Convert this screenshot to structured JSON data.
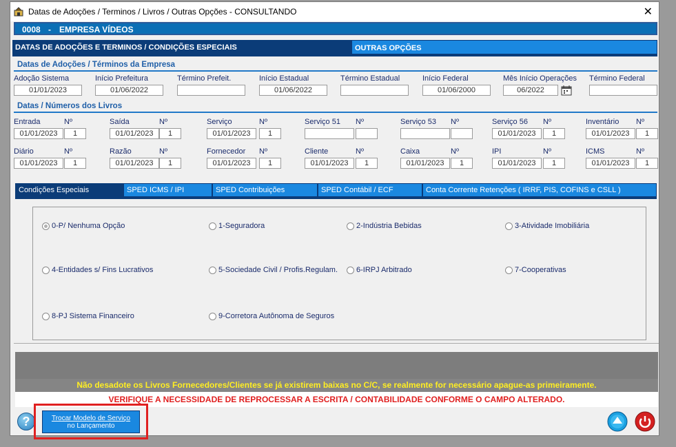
{
  "window": {
    "title": "Datas de Adoções / Terminos / Livros / Outras Opções - CONSULTANDO"
  },
  "empresa": {
    "code": "0008",
    "separator": "-",
    "name": "EMPRESA VÍDEOS"
  },
  "main_tabs": {
    "active": "DATAS DE ADOÇÕES E TERMINOS / CONDIÇÕES ESPECIAIS",
    "other": "OUTRAS OPÇÕES"
  },
  "adocoes": {
    "heading": "Datas de Adoções / Términos da Empresa",
    "fields": [
      {
        "label": "Adoção Sistema",
        "value": "01/01/2023"
      },
      {
        "label": "Início Prefeitura",
        "value": "01/06/2022"
      },
      {
        "label": "Término Prefeit.",
        "value": ""
      },
      {
        "label": "Início Estadual",
        "value": "01/06/2022"
      },
      {
        "label": "Término Estadual",
        "value": ""
      },
      {
        "label": "Início Federal",
        "value": "01/06/2000"
      },
      {
        "label": "Mês Início Operações",
        "value": "06/2022"
      },
      {
        "label": "Término Federal",
        "value": ""
      }
    ]
  },
  "livros": {
    "heading": "Datas / Números dos Livros",
    "num_label": "Nº",
    "row1": [
      {
        "label": "Entrada",
        "date": "01/01/2023",
        "num": "1"
      },
      {
        "label": "Saída",
        "date": "01/01/2023",
        "num": "1"
      },
      {
        "label": "Serviço",
        "date": "01/01/2023",
        "num": "1"
      },
      {
        "label": "Serviço 51",
        "date": "",
        "num": ""
      },
      {
        "label": "Serviço 53",
        "date": "",
        "num": ""
      },
      {
        "label": "Serviço 56",
        "date": "01/01/2023",
        "num": "1"
      },
      {
        "label": "Inventário",
        "date": "01/01/2023",
        "num": "1"
      }
    ],
    "row2": [
      {
        "label": "Diário",
        "date": "01/01/2023",
        "num": "1"
      },
      {
        "label": "Razão",
        "date": "01/01/2023",
        "num": "1"
      },
      {
        "label": "Fornecedor",
        "date": "01/01/2023",
        "num": "1"
      },
      {
        "label": "Cliente",
        "date": "01/01/2023",
        "num": "1"
      },
      {
        "label": "Caixa",
        "date": "01/01/2023",
        "num": "1"
      },
      {
        "label": "IPI",
        "date": "01/01/2023",
        "num": "1"
      },
      {
        "label": "ICMS",
        "date": "01/01/2023",
        "num": "1"
      }
    ]
  },
  "sub_tabs": [
    "Condições Especiais",
    "SPED ICMS / IPI",
    "SPED Contribuições",
    "SPED Contábil / ECF",
    "Conta Corrente Retenções ( IRRF, PIS, COFINS  e  CSLL )"
  ],
  "options": [
    "0-P/ Nenhuma Opção",
    "1-Seguradora",
    "2-Indústria Bebidas",
    "3-Atividade Imobiliária",
    "4-Entidades s/ Fins Lucrativos",
    "5-Sociedade Civil / Profis.Regulam.",
    "6-IRPJ Arbitrado",
    "7-Cooperativas",
    "8-PJ Sistema Financeiro",
    "9-Corretora Autônoma de Seguros"
  ],
  "selected_option": "0-P/ Nenhuma Opção",
  "messages": {
    "warning_yellow": "Não desadote os Livros Fornecedores/Clientes se já existirem baixas no C/C, se realmente for necessário apague-as primeiramente.",
    "warning_red": "VERIFIQUE A NECESSIDADE DE REPROCESSAR A ESCRITA / CONTABILIDADE CONFORME O CAMPO ALTERADO."
  },
  "buttons": {
    "trocar_line1": "Trocar Modelo de Serviço",
    "trocar_line2": "no Lançamento",
    "help": "?"
  },
  "colors": {
    "accent": "#1a88e0",
    "dark_tab": "#0b3c78",
    "warn_yellow": "#ffee22",
    "warn_red": "#e02020",
    "highlight": "#e02020"
  },
  "icons": {
    "help": "help-icon",
    "up": "up-arrow-icon",
    "power": "power-icon",
    "calendar": "calendar-icon",
    "close": "close-icon",
    "app": "app-icon"
  }
}
